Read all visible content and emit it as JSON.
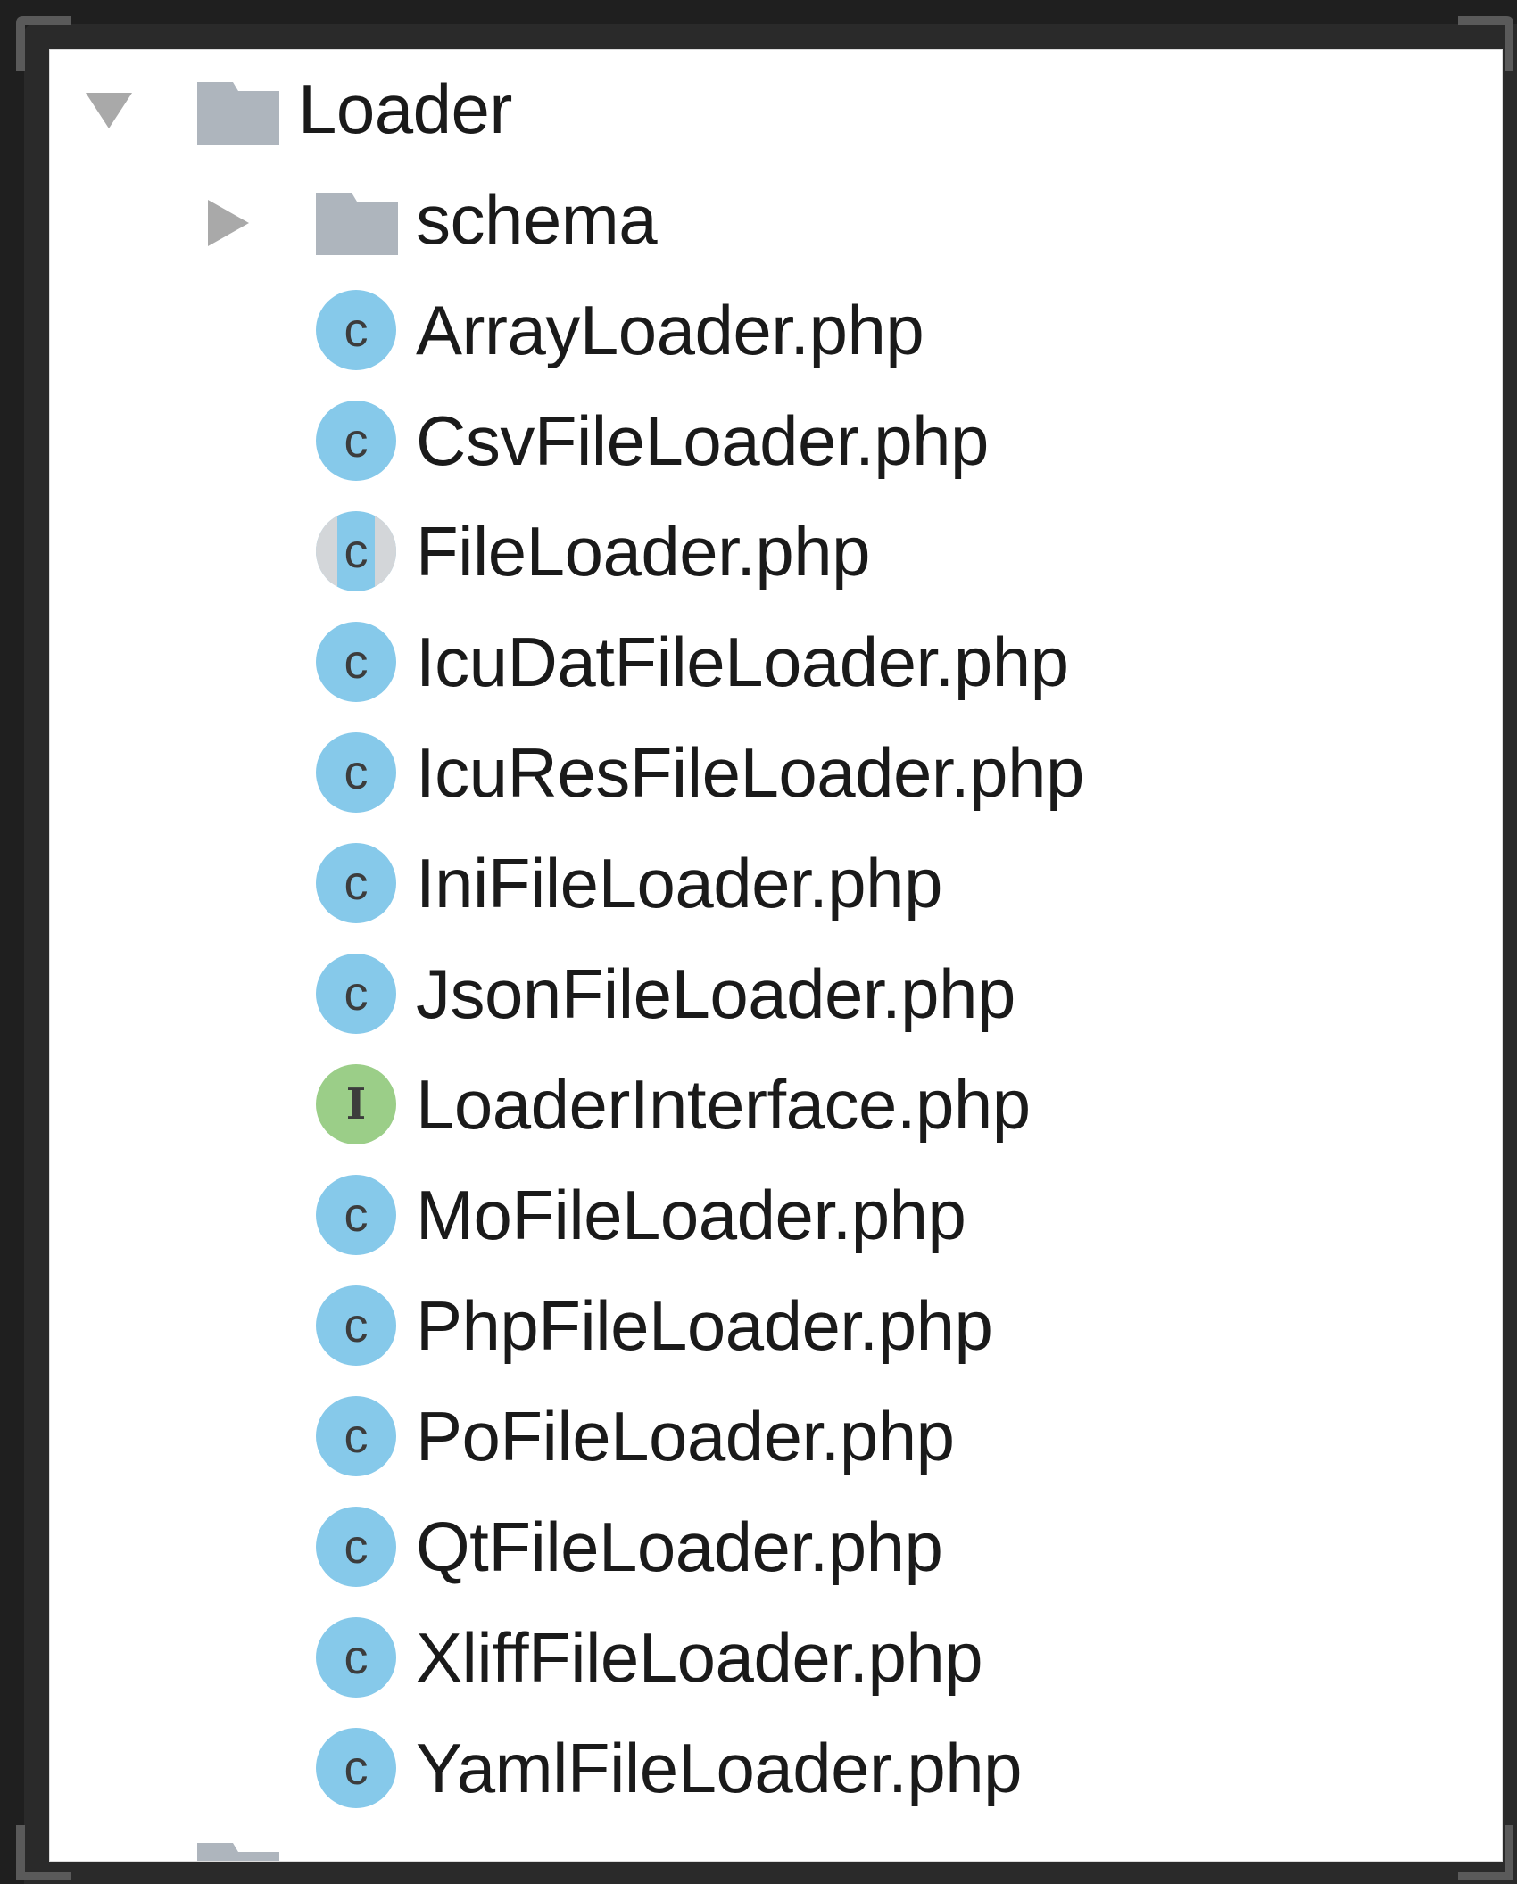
{
  "tree": {
    "root": {
      "label": "Loader",
      "expanded": true,
      "icon": "folder-icon"
    },
    "children": [
      {
        "label": "schema",
        "type": "folder",
        "expanded": false,
        "icon": "folder-icon"
      },
      {
        "label": "ArrayLoader.php",
        "type": "class",
        "badge": "c"
      },
      {
        "label": "CsvFileLoader.php",
        "type": "class",
        "badge": "c"
      },
      {
        "label": "FileLoader.php",
        "type": "abstract-class",
        "badge": "c"
      },
      {
        "label": "IcuDatFileLoader.php",
        "type": "class",
        "badge": "c"
      },
      {
        "label": "IcuResFileLoader.php",
        "type": "class",
        "badge": "c"
      },
      {
        "label": "IniFileLoader.php",
        "type": "class",
        "badge": "c"
      },
      {
        "label": "JsonFileLoader.php",
        "type": "class",
        "badge": "c"
      },
      {
        "label": "LoaderInterface.php",
        "type": "interface",
        "badge": "I"
      },
      {
        "label": "MoFileLoader.php",
        "type": "class",
        "badge": "c"
      },
      {
        "label": "PhpFileLoader.php",
        "type": "class",
        "badge": "c"
      },
      {
        "label": "PoFileLoader.php",
        "type": "class",
        "badge": "c"
      },
      {
        "label": "QtFileLoader.php",
        "type": "class",
        "badge": "c"
      },
      {
        "label": "XliffFileLoader.php",
        "type": "class",
        "badge": "c"
      },
      {
        "label": "YamlFileLoader.php",
        "type": "class",
        "badge": "c"
      }
    ]
  },
  "colors": {
    "class_badge": "#86c9ea",
    "interface_badge": "#9bce88",
    "folder": "#aeb5bd",
    "arrow": "#a9a9a9",
    "text": "#1a1a1a",
    "background": "#ffffff"
  }
}
